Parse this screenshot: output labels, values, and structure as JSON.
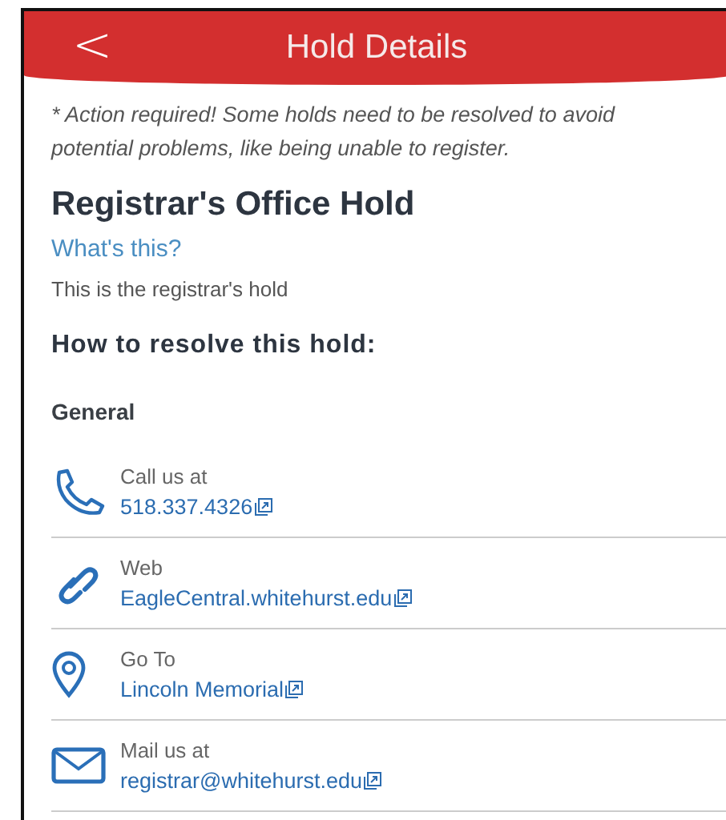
{
  "header": {
    "back": "<",
    "title": "Hold Details"
  },
  "notice": "* Action required! Some holds need to be resolved to avoid potential problems, like being unable to register.",
  "hold": {
    "title": "Registrar's Office Hold",
    "help_link": "What's this?",
    "description": "This is the registrar's hold"
  },
  "resolve_heading": "How to resolve this hold:",
  "section": "General",
  "contacts": [
    {
      "kind": "phone",
      "label": "Call us at",
      "link": "518.337.4326"
    },
    {
      "kind": "web",
      "label": "Web",
      "link": "EagleCentral.whitehurst.edu"
    },
    {
      "kind": "location",
      "label": "Go To",
      "link": "Lincoln Memorial"
    },
    {
      "kind": "mail",
      "label": "Mail us at",
      "link": "registrar@whitehurst.edu"
    }
  ]
}
